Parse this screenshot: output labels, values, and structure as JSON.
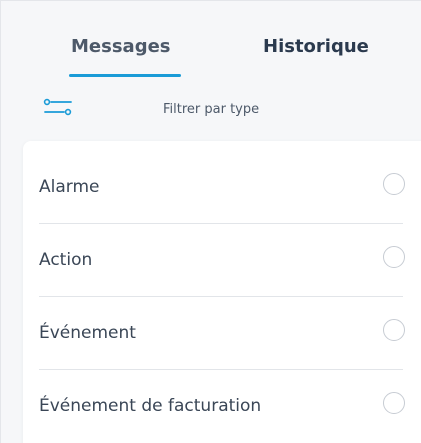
{
  "tabs": {
    "messages": "Messages",
    "history": "Historique",
    "active": "messages"
  },
  "filter": {
    "icon": "filter-sliders-icon",
    "label": "Filtrer par type"
  },
  "options": [
    {
      "label": "Alarme",
      "selected": false
    },
    {
      "label": "Action",
      "selected": false
    },
    {
      "label": "Événement",
      "selected": false
    },
    {
      "label": "Événement de facturation",
      "selected": false
    }
  ],
  "colors": {
    "accent": "#1a9bd7",
    "text": "#3a4656",
    "tab_inactive": "#4d5969",
    "tab_active_dark": "#2b3a4e"
  }
}
